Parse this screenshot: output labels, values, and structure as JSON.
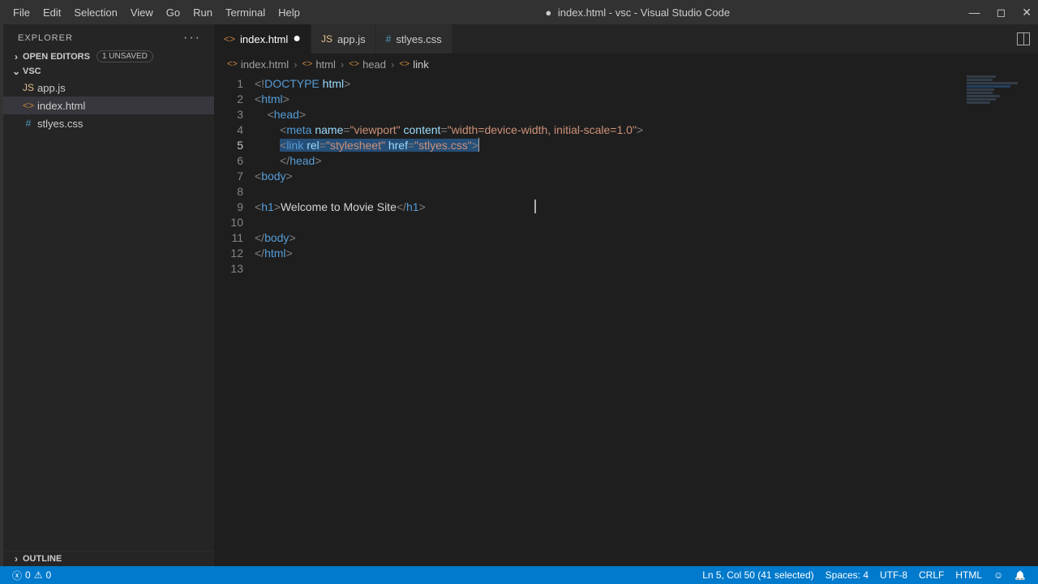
{
  "menu": {
    "items": [
      "File",
      "Edit",
      "Selection",
      "View",
      "Go",
      "Run",
      "Terminal",
      "Help"
    ]
  },
  "window_title": "index.html - vsc - Visual Studio Code",
  "window_dirty": "●",
  "sidebar": {
    "title": "EXPLORER",
    "open_editors": "OPEN EDITORS",
    "unsaved_badge": "1 UNSAVED",
    "project": "VSC",
    "files": [
      {
        "name": "app.js",
        "icon": "JS",
        "cls": "js-color"
      },
      {
        "name": "index.html",
        "icon": "<>",
        "cls": "html-color",
        "active": true
      },
      {
        "name": "stlyes.css",
        "icon": "#",
        "cls": "css-color"
      }
    ],
    "outline": "OUTLINE"
  },
  "tabs": [
    {
      "name": "index.html",
      "icon": "<>",
      "cls": "html-color",
      "active": true,
      "dirty": "●"
    },
    {
      "name": "app.js",
      "icon": "JS",
      "cls": "js-color"
    },
    {
      "name": "stlyes.css",
      "icon": "#",
      "cls": "css-color"
    }
  ],
  "breadcrumbs": [
    "index.html",
    "html",
    "head",
    "link"
  ],
  "code": {
    "lines": 13,
    "current_line": 5,
    "h1_text": "Welcome to Movie Site"
  },
  "status": {
    "errors": "0",
    "warnings": "0",
    "position": "Ln 5, Col 50 (41 selected)",
    "spaces": "Spaces: 4",
    "encoding": "UTF-8",
    "eol": "CRLF",
    "language": "HTML"
  }
}
